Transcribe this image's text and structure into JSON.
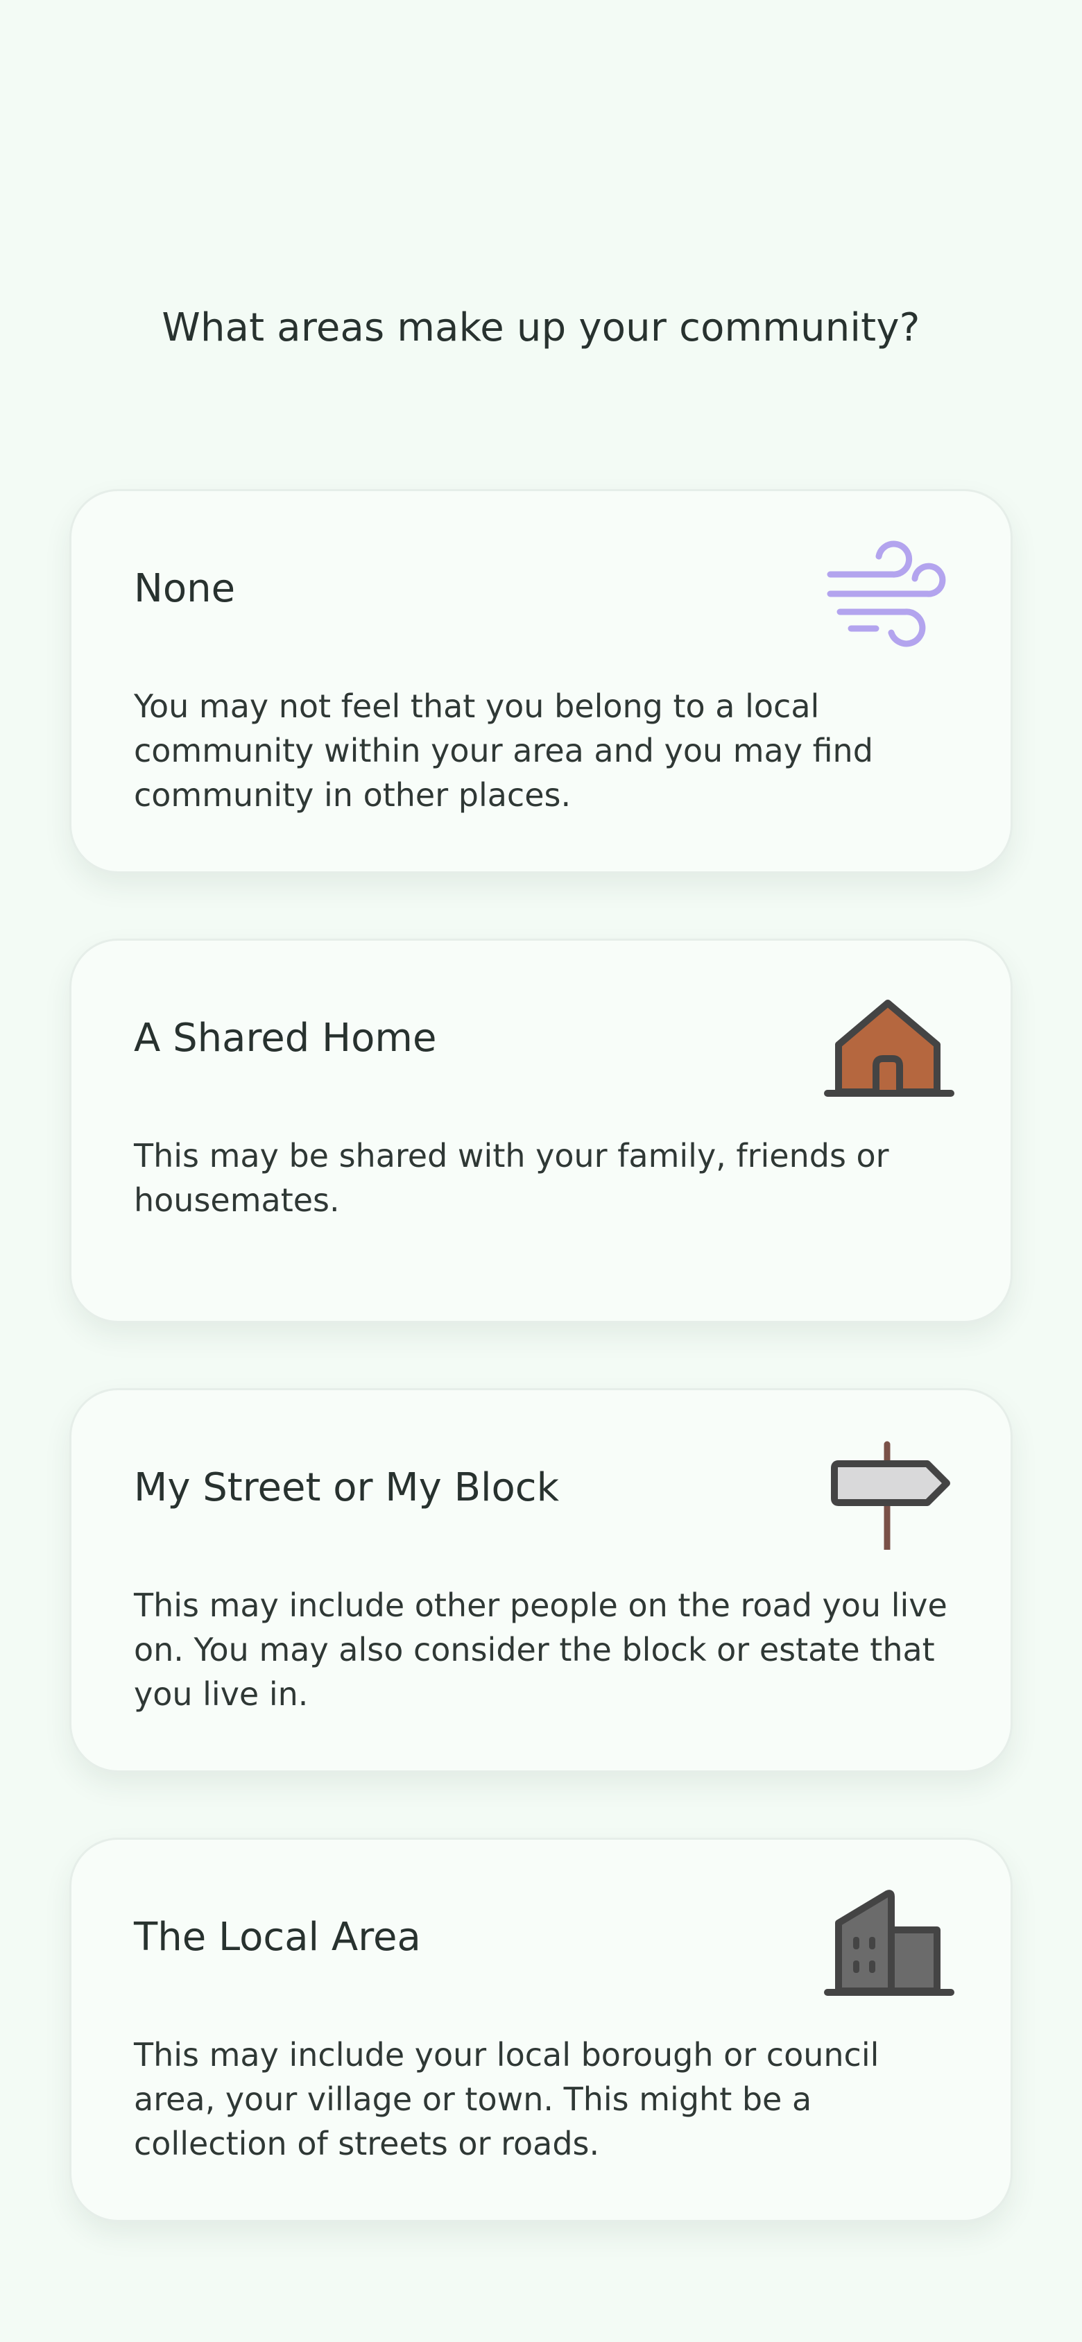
{
  "page": {
    "title": "What areas make up your community?"
  },
  "colors": {
    "background": "#f3fbf5",
    "card_background": "#f8fdf9",
    "wind_icon": "#b3a4ee",
    "house_fill": "#b5673f",
    "signpost_fill": "#d9d9da",
    "signpost_pole": "#7a5148",
    "building_fill": "#6b6b6b",
    "icon_outline": "#444444"
  },
  "options": [
    {
      "title": "None",
      "description": "You may not feel that you belong to a local community within your area and you may find community in other places.",
      "icon": "wind-icon"
    },
    {
      "title": "A Shared Home",
      "description": "This may be shared with your family, friends or housemates.",
      "icon": "house-icon"
    },
    {
      "title": "My Street or My Block",
      "description": "This may include other people on the road you live on. You may also consider the block or estate that you live in.",
      "icon": "signpost-icon"
    },
    {
      "title": "The Local Area",
      "description": "This may include your local borough or council area, your village or town. This might be a collection of streets or roads.",
      "icon": "building-icon"
    }
  ]
}
